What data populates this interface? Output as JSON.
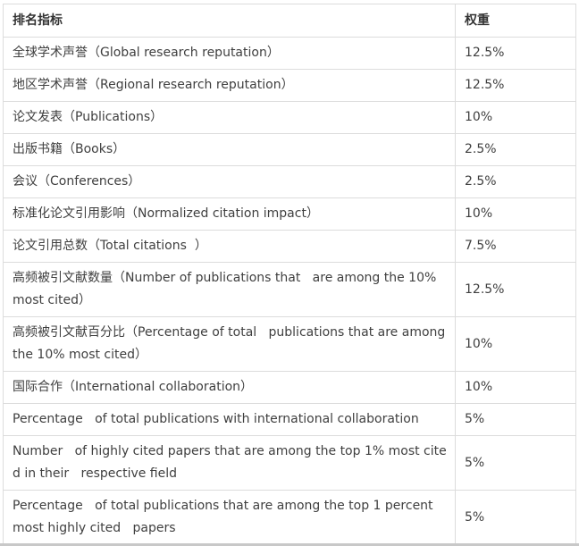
{
  "table": {
    "headers": [
      "排名指标",
      "权重"
    ],
    "rows": [
      {
        "indicator": "全球学术声誉（Global research reputation）",
        "weight": "12.5%"
      },
      {
        "indicator": "地区学术声誉（Regional research reputation）",
        "weight": "12.5%"
      },
      {
        "indicator": "论文发表（Publications）",
        "weight": "10%"
      },
      {
        "indicator": "出版书籍（Books）",
        "weight": "2.5%"
      },
      {
        "indicator": "会议（Conferences）",
        "weight": "2.5%"
      },
      {
        "indicator": "标准化论文引用影响（Normalized citation impact）",
        "weight": "10%"
      },
      {
        "indicator": "论文引用总数（Total citations  ）",
        "weight": "7.5%"
      },
      {
        "indicator": "高频被引文献数量（Number of publications that   are among the 10% most cited）",
        "weight": "12.5%"
      },
      {
        "indicator": "高频被引文献百分比（Percentage of total   publications that are among the 10% most cited）",
        "weight": "10%"
      },
      {
        "indicator": "国际合作（International collaboration）",
        "weight": "10%"
      },
      {
        "indicator": "Percentage   of total publications with international collaboration",
        "weight": "5%"
      },
      {
        "indicator": "Number   of highly cited papers that are among the top 1% most cited in their   respective field",
        "weight": "5%"
      },
      {
        "indicator": "Percentage   of total publications that are among the top 1 percent most highly cited   papers",
        "weight": "5%"
      }
    ]
  }
}
